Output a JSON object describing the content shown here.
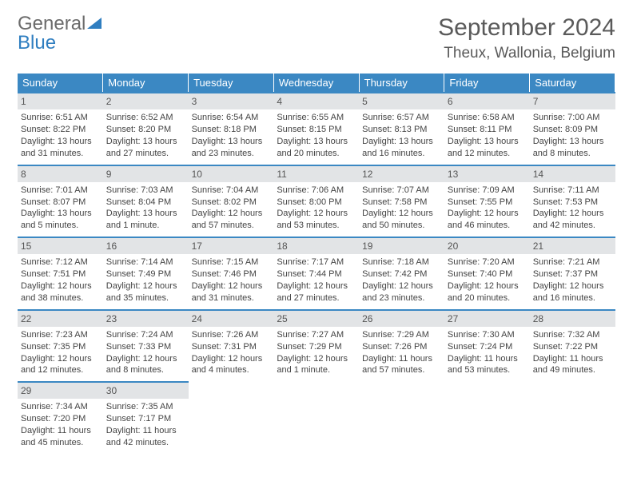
{
  "logo": {
    "general": "General",
    "blue": "Blue"
  },
  "title": "September 2024",
  "location": "Theux, Wallonia, Belgium",
  "weekdays": [
    "Sunday",
    "Monday",
    "Tuesday",
    "Wednesday",
    "Thursday",
    "Friday",
    "Saturday"
  ],
  "days": [
    {
      "n": "1",
      "sr": "Sunrise: 6:51 AM",
      "ss": "Sunset: 8:22 PM",
      "dl": "Daylight: 13 hours and 31 minutes."
    },
    {
      "n": "2",
      "sr": "Sunrise: 6:52 AM",
      "ss": "Sunset: 8:20 PM",
      "dl": "Daylight: 13 hours and 27 minutes."
    },
    {
      "n": "3",
      "sr": "Sunrise: 6:54 AM",
      "ss": "Sunset: 8:18 PM",
      "dl": "Daylight: 13 hours and 23 minutes."
    },
    {
      "n": "4",
      "sr": "Sunrise: 6:55 AM",
      "ss": "Sunset: 8:15 PM",
      "dl": "Daylight: 13 hours and 20 minutes."
    },
    {
      "n": "5",
      "sr": "Sunrise: 6:57 AM",
      "ss": "Sunset: 8:13 PM",
      "dl": "Daylight: 13 hours and 16 minutes."
    },
    {
      "n": "6",
      "sr": "Sunrise: 6:58 AM",
      "ss": "Sunset: 8:11 PM",
      "dl": "Daylight: 13 hours and 12 minutes."
    },
    {
      "n": "7",
      "sr": "Sunrise: 7:00 AM",
      "ss": "Sunset: 8:09 PM",
      "dl": "Daylight: 13 hours and 8 minutes."
    },
    {
      "n": "8",
      "sr": "Sunrise: 7:01 AM",
      "ss": "Sunset: 8:07 PM",
      "dl": "Daylight: 13 hours and 5 minutes."
    },
    {
      "n": "9",
      "sr": "Sunrise: 7:03 AM",
      "ss": "Sunset: 8:04 PM",
      "dl": "Daylight: 13 hours and 1 minute."
    },
    {
      "n": "10",
      "sr": "Sunrise: 7:04 AM",
      "ss": "Sunset: 8:02 PM",
      "dl": "Daylight: 12 hours and 57 minutes."
    },
    {
      "n": "11",
      "sr": "Sunrise: 7:06 AM",
      "ss": "Sunset: 8:00 PM",
      "dl": "Daylight: 12 hours and 53 minutes."
    },
    {
      "n": "12",
      "sr": "Sunrise: 7:07 AM",
      "ss": "Sunset: 7:58 PM",
      "dl": "Daylight: 12 hours and 50 minutes."
    },
    {
      "n": "13",
      "sr": "Sunrise: 7:09 AM",
      "ss": "Sunset: 7:55 PM",
      "dl": "Daylight: 12 hours and 46 minutes."
    },
    {
      "n": "14",
      "sr": "Sunrise: 7:11 AM",
      "ss": "Sunset: 7:53 PM",
      "dl": "Daylight: 12 hours and 42 minutes."
    },
    {
      "n": "15",
      "sr": "Sunrise: 7:12 AM",
      "ss": "Sunset: 7:51 PM",
      "dl": "Daylight: 12 hours and 38 minutes."
    },
    {
      "n": "16",
      "sr": "Sunrise: 7:14 AM",
      "ss": "Sunset: 7:49 PM",
      "dl": "Daylight: 12 hours and 35 minutes."
    },
    {
      "n": "17",
      "sr": "Sunrise: 7:15 AM",
      "ss": "Sunset: 7:46 PM",
      "dl": "Daylight: 12 hours and 31 minutes."
    },
    {
      "n": "18",
      "sr": "Sunrise: 7:17 AM",
      "ss": "Sunset: 7:44 PM",
      "dl": "Daylight: 12 hours and 27 minutes."
    },
    {
      "n": "19",
      "sr": "Sunrise: 7:18 AM",
      "ss": "Sunset: 7:42 PM",
      "dl": "Daylight: 12 hours and 23 minutes."
    },
    {
      "n": "20",
      "sr": "Sunrise: 7:20 AM",
      "ss": "Sunset: 7:40 PM",
      "dl": "Daylight: 12 hours and 20 minutes."
    },
    {
      "n": "21",
      "sr": "Sunrise: 7:21 AM",
      "ss": "Sunset: 7:37 PM",
      "dl": "Daylight: 12 hours and 16 minutes."
    },
    {
      "n": "22",
      "sr": "Sunrise: 7:23 AM",
      "ss": "Sunset: 7:35 PM",
      "dl": "Daylight: 12 hours and 12 minutes."
    },
    {
      "n": "23",
      "sr": "Sunrise: 7:24 AM",
      "ss": "Sunset: 7:33 PM",
      "dl": "Daylight: 12 hours and 8 minutes."
    },
    {
      "n": "24",
      "sr": "Sunrise: 7:26 AM",
      "ss": "Sunset: 7:31 PM",
      "dl": "Daylight: 12 hours and 4 minutes."
    },
    {
      "n": "25",
      "sr": "Sunrise: 7:27 AM",
      "ss": "Sunset: 7:29 PM",
      "dl": "Daylight: 12 hours and 1 minute."
    },
    {
      "n": "26",
      "sr": "Sunrise: 7:29 AM",
      "ss": "Sunset: 7:26 PM",
      "dl": "Daylight: 11 hours and 57 minutes."
    },
    {
      "n": "27",
      "sr": "Sunrise: 7:30 AM",
      "ss": "Sunset: 7:24 PM",
      "dl": "Daylight: 11 hours and 53 minutes."
    },
    {
      "n": "28",
      "sr": "Sunrise: 7:32 AM",
      "ss": "Sunset: 7:22 PM",
      "dl": "Daylight: 11 hours and 49 minutes."
    },
    {
      "n": "29",
      "sr": "Sunrise: 7:34 AM",
      "ss": "Sunset: 7:20 PM",
      "dl": "Daylight: 11 hours and 45 minutes."
    },
    {
      "n": "30",
      "sr": "Sunrise: 7:35 AM",
      "ss": "Sunset: 7:17 PM",
      "dl": "Daylight: 11 hours and 42 minutes."
    }
  ],
  "chart_data": {
    "type": "table",
    "title": "September 2024 sunrise/sunset — Theux, Wallonia, Belgium",
    "columns": [
      "day",
      "sunrise",
      "sunset",
      "daylight_minutes"
    ],
    "rows": [
      [
        1,
        "6:51 AM",
        "8:22 PM",
        811
      ],
      [
        2,
        "6:52 AM",
        "8:20 PM",
        807
      ],
      [
        3,
        "6:54 AM",
        "8:18 PM",
        803
      ],
      [
        4,
        "6:55 AM",
        "8:15 PM",
        800
      ],
      [
        5,
        "6:57 AM",
        "8:13 PM",
        796
      ],
      [
        6,
        "6:58 AM",
        "8:11 PM",
        792
      ],
      [
        7,
        "7:00 AM",
        "8:09 PM",
        788
      ],
      [
        8,
        "7:01 AM",
        "8:07 PM",
        785
      ],
      [
        9,
        "7:03 AM",
        "8:04 PM",
        781
      ],
      [
        10,
        "7:04 AM",
        "8:02 PM",
        777
      ],
      [
        11,
        "7:06 AM",
        "8:00 PM",
        773
      ],
      [
        12,
        "7:07 AM",
        "7:58 PM",
        770
      ],
      [
        13,
        "7:09 AM",
        "7:55 PM",
        766
      ],
      [
        14,
        "7:11 AM",
        "7:53 PM",
        762
      ],
      [
        15,
        "7:12 AM",
        "7:51 PM",
        758
      ],
      [
        16,
        "7:14 AM",
        "7:49 PM",
        755
      ],
      [
        17,
        "7:15 AM",
        "7:46 PM",
        751
      ],
      [
        18,
        "7:17 AM",
        "7:44 PM",
        747
      ],
      [
        19,
        "7:18 AM",
        "7:42 PM",
        743
      ],
      [
        20,
        "7:20 AM",
        "7:40 PM",
        740
      ],
      [
        21,
        "7:21 AM",
        "7:37 PM",
        736
      ],
      [
        22,
        "7:23 AM",
        "7:35 PM",
        732
      ],
      [
        23,
        "7:24 AM",
        "7:33 PM",
        728
      ],
      [
        24,
        "7:26 AM",
        "7:31 PM",
        724
      ],
      [
        25,
        "7:27 AM",
        "7:29 PM",
        721
      ],
      [
        26,
        "7:29 AM",
        "7:26 PM",
        717
      ],
      [
        27,
        "7:30 AM",
        "7:24 PM",
        713
      ],
      [
        28,
        "7:32 AM",
        "7:22 PM",
        709
      ],
      [
        29,
        "7:34 AM",
        "7:20 PM",
        705
      ],
      [
        30,
        "7:35 AM",
        "7:17 PM",
        702
      ]
    ]
  }
}
